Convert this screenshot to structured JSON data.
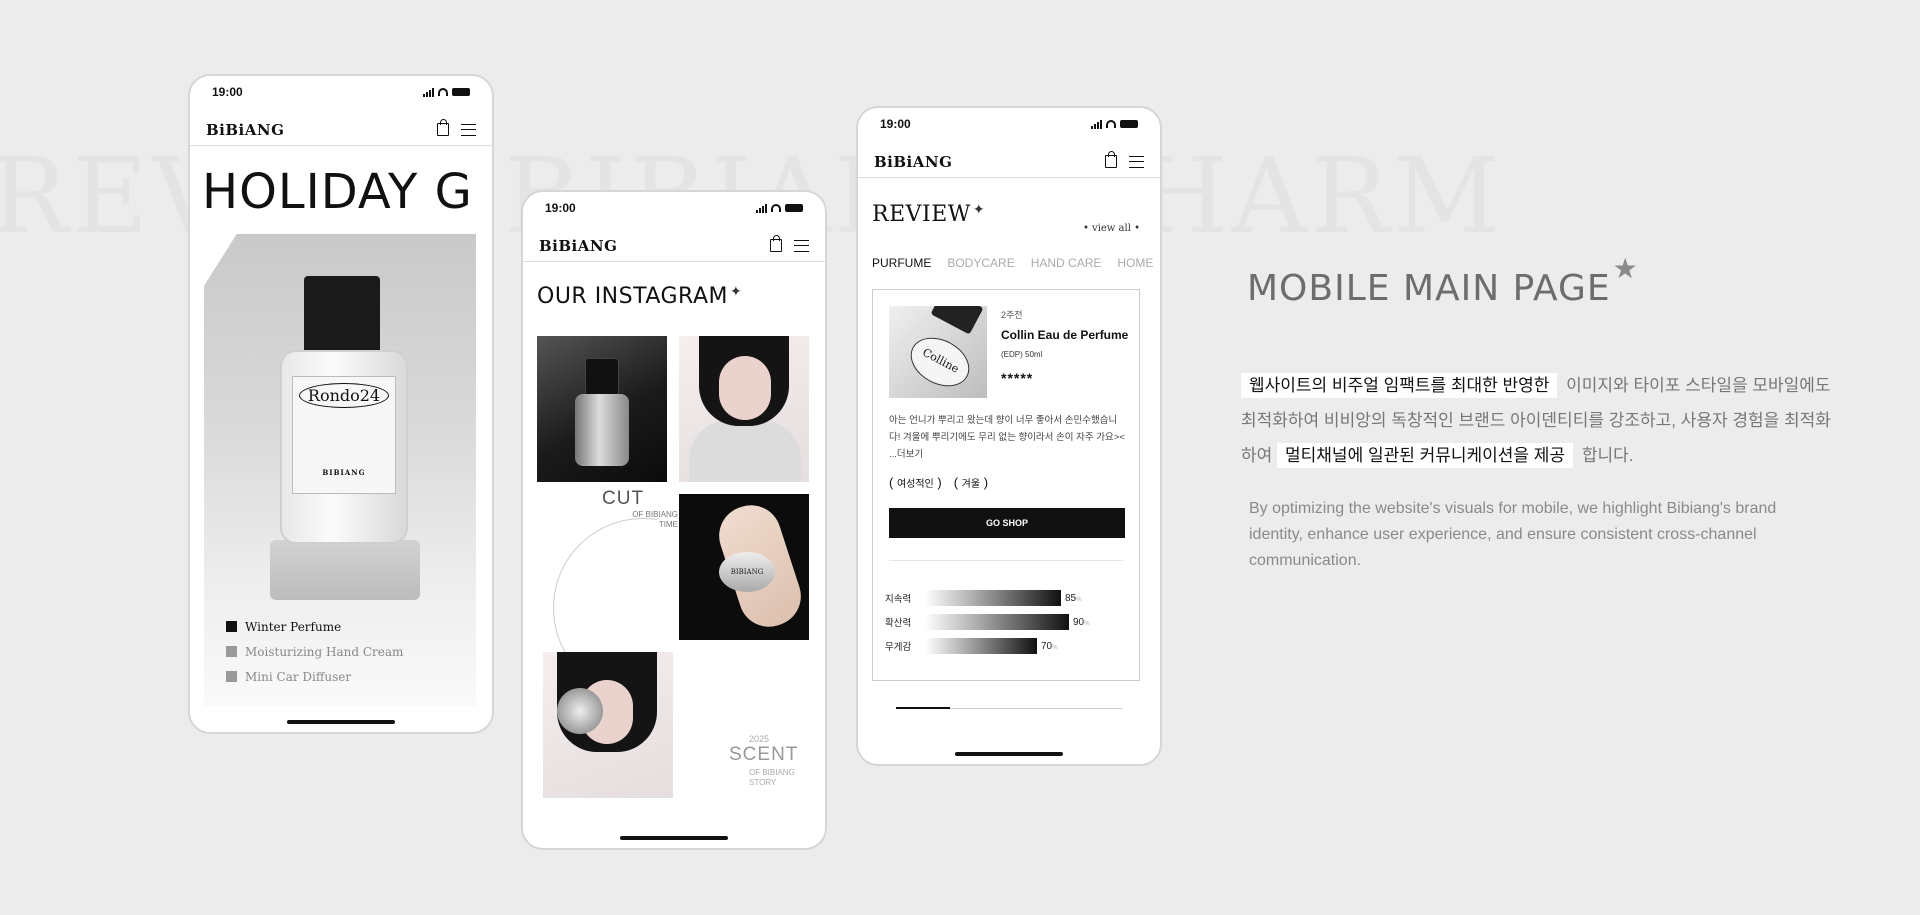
{
  "watermark": "REVIEW BIBIANG CHARM",
  "phone_common": {
    "time": "19:00",
    "logo": "BiBiANG"
  },
  "phone1": {
    "headline": "HOLIDAY G",
    "bottle_name": "Rondo24",
    "bottle_brand": "BIBIANG",
    "products": [
      "Winter Perfume",
      "Moisturizing Hand Cream",
      "Mini Car Diffuser"
    ],
    "active_product_index": 0
  },
  "phone2": {
    "section_title": "OUR INSTAGRAM",
    "cut_title": "CUT",
    "cut_sub": "OF BIBIANG TIME",
    "cap_label": "BIBIANG",
    "scent_year": "2025",
    "scent_title": "SCENT",
    "scent_sub": "OF BIBIANG STORY"
  },
  "phone3": {
    "section_title": "REVIEW",
    "view_all": "• view all •",
    "tabs": [
      "PURFUME",
      "BODYCARE",
      "HAND CARE",
      "HOME"
    ],
    "active_tab_index": 0,
    "review": {
      "image_label": "Colline",
      "week": "2주전",
      "product_name": "Collin Eau de Perfume",
      "volume": "(EDP)  50ml",
      "stars": "*****",
      "body": "아는 언니가 뿌리고 왔는데 향이 너무 좋아서 손민수했습니다! 겨울에 뿌리기에도 무리 없는 향이라서 손이 자주 가요>< ...더보기",
      "tags": [
        "여성적인",
        "겨울"
      ],
      "cta": "GO SHOP"
    },
    "metrics": [
      {
        "label": "지속력",
        "value": 85,
        "unit": "%"
      },
      {
        "label": "확산력",
        "value": 90,
        "unit": "%"
      },
      {
        "label": "무게감",
        "value": 70,
        "unit": "%"
      }
    ]
  },
  "info": {
    "heading": "MOBILE MAIN PAGE",
    "kr_hl1": "웹사이트의 비주얼 임팩트를 최대한 반영한",
    "kr_text1": "이미지와 타이포 스타일을 모바일에도 최적화하여 비비앙의 독창적인 브랜드 아이덴티티를 강조하고, 사용자 경험을 최적화하여",
    "kr_hl2": "멀티채널에 일관된 커뮤니케이션을 제공",
    "kr_text2": "합니다.",
    "en": "By optimizing the website's visuals for mobile, we highlight Bibiang's brand identity, enhance user experience, and ensure consistent cross-channel communication."
  }
}
